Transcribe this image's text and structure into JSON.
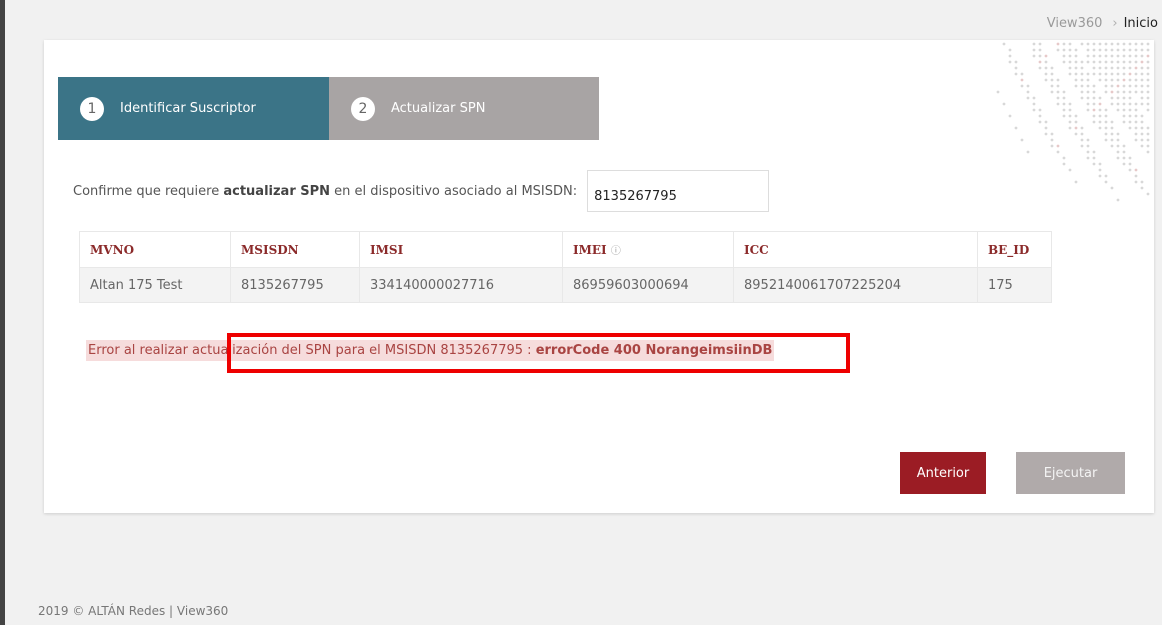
{
  "breadcrumb": {
    "parent": "View360",
    "current": "Inicio"
  },
  "steps": [
    {
      "number": "1",
      "label": "Identificar Suscriptor",
      "active": true
    },
    {
      "number": "2",
      "label": "Actualizar SPN",
      "active": false
    }
  ],
  "confirm": {
    "text_before": "Confirme que requiere ",
    "text_bold": "actualizar SPN",
    "text_after": " en el dispositivo asociado al MSISDN:",
    "msisdn_value": "8135267795"
  },
  "table": {
    "headers": [
      "MVNO",
      "MSISDN",
      "IMSI",
      "IMEI",
      "ICC",
      "BE_ID"
    ],
    "info_icon_glyph": "ⓘ",
    "rows": [
      [
        "Altan 175 Test",
        "8135267795",
        "334140000027716",
        "86959603000694",
        "8952140061707225204",
        "175"
      ]
    ]
  },
  "error": {
    "text": "Error al realizar actualización del SPN para el MSISDN 8135267795 : ",
    "code": "errorCode 400 NorangeimsiinDB"
  },
  "buttons": {
    "previous": "Anterior",
    "execute": "Ejecutar"
  },
  "footer": "2019 © ALTÁN Redes | View360",
  "colors": {
    "step_active": "#3b7487",
    "step_inactive": "#a8a4a4",
    "primary_button": "#9b1c24",
    "error_text": "#a94442",
    "highlight": "#ee0000"
  }
}
